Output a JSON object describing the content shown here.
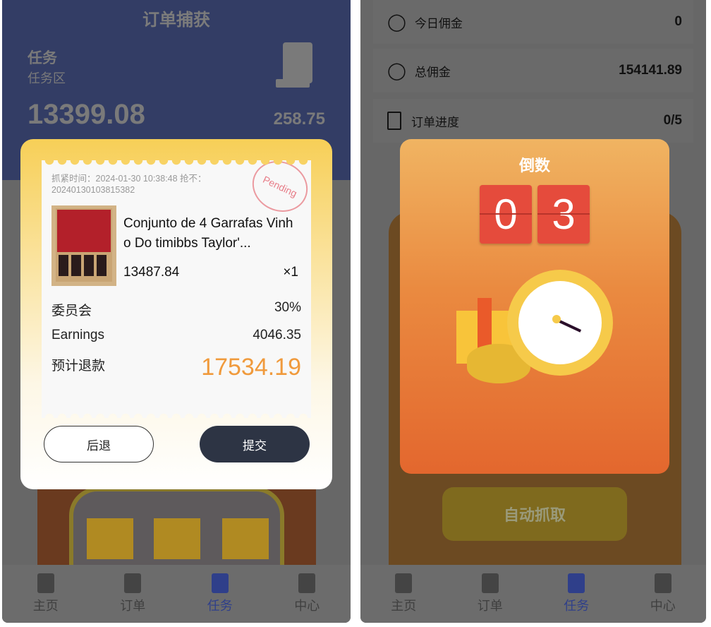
{
  "left": {
    "title": "订单捕获",
    "task_label": "任务",
    "task_area": "任务区",
    "balance": "13399.08",
    "secondary_value": "258.75",
    "modal": {
      "time_line": "抓紧时间：2024-01-30 10:38:48 抢不：",
      "order_no": "20240130103815382",
      "stamp": "Pending",
      "product_name": "Conjunto de 4 Garrafas Vinho Do timibbs Taylor'...",
      "price": "13487.84",
      "qty": "×1",
      "commission_label": "委员会",
      "commission_value": "30%",
      "earnings_label": "Earnings",
      "earnings_value": "4046.35",
      "refund_label": "预计退款",
      "refund_value": "17534.19",
      "back_label": "后退",
      "submit_label": "提交"
    }
  },
  "right": {
    "stats": [
      {
        "label": "今日佣金",
        "value": "0",
        "icon": "user-icon"
      },
      {
        "label": "总佣金",
        "value": "154141.89",
        "icon": "users-icon"
      },
      {
        "label": "订单进度",
        "value": "0/5",
        "icon": "document-icon"
      }
    ],
    "countdown": {
      "title": "倒数",
      "digits": [
        "0",
        "3"
      ]
    },
    "auto_button": "自动抓取"
  },
  "nav": [
    {
      "label": "主页",
      "icon": "home-icon"
    },
    {
      "label": "订单",
      "icon": "list-icon"
    },
    {
      "label": "任务",
      "icon": "task-icon",
      "active": true
    },
    {
      "label": "中心",
      "icon": "person-icon"
    }
  ],
  "colors": {
    "accent": "#f09a3c",
    "nav_active": "#2f3f8a",
    "submit": "#2d3444",
    "countdown": "#e54b3c"
  }
}
